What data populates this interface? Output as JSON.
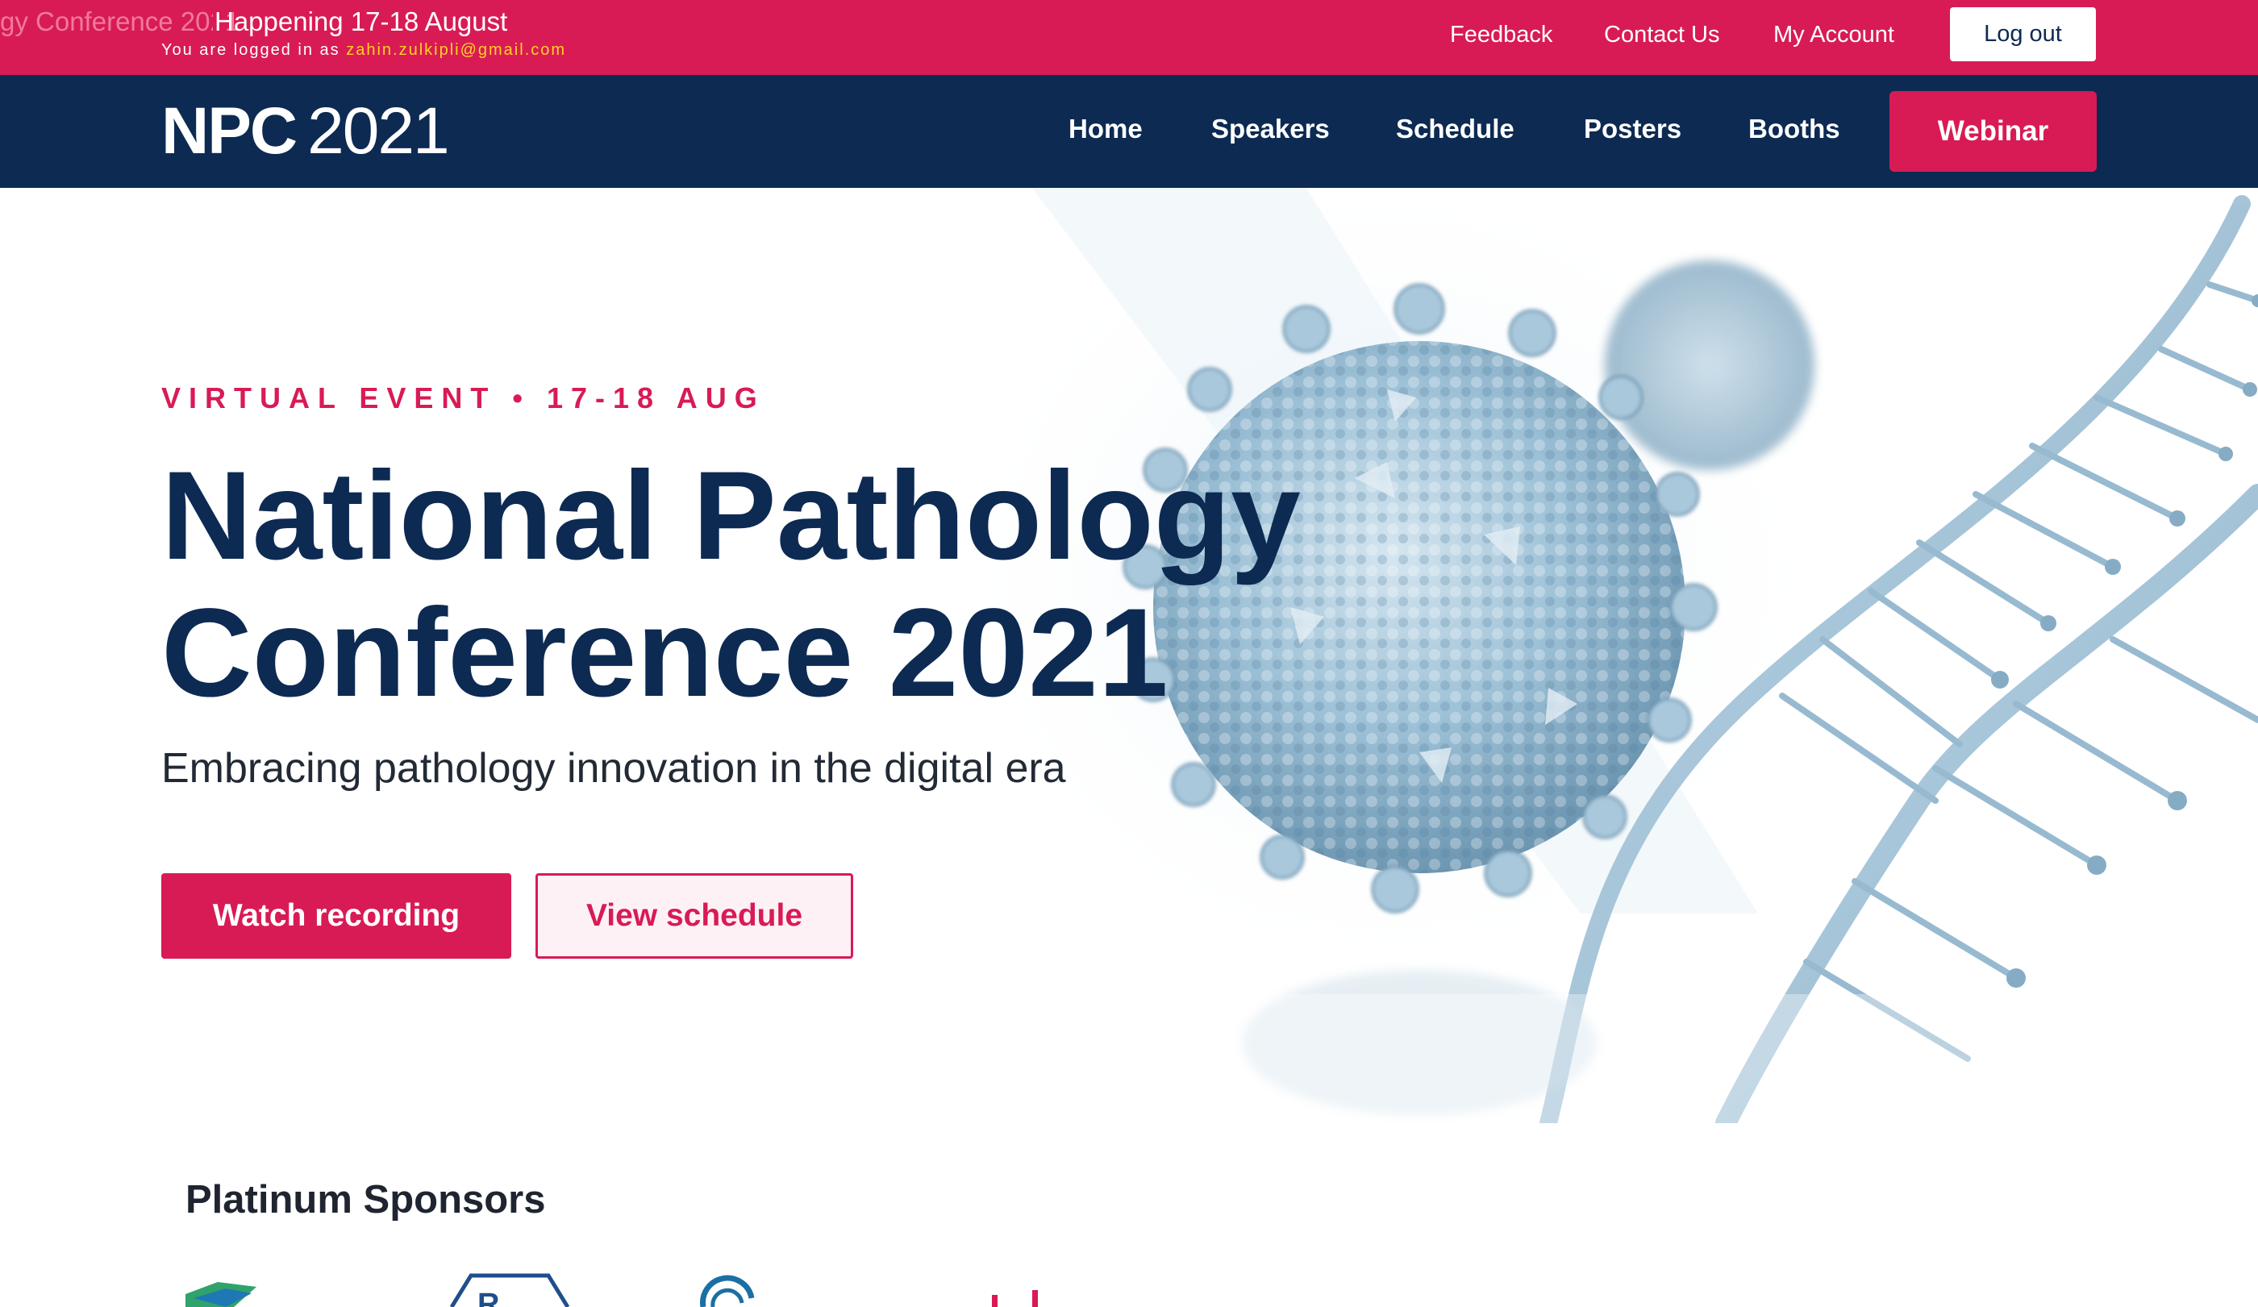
{
  "topbar": {
    "marquee_text": "gy Conference 2021",
    "happening": "Happening 17-18 August",
    "logged_prefix": "You are logged in as",
    "logged_email": "zahin.zulkipli@gmail.com",
    "links": [
      "Feedback",
      "Contact Us",
      "My Account"
    ],
    "logout_label": "Log out"
  },
  "nav": {
    "logo_text": "NPC",
    "logo_year": "2021",
    "items": [
      "Home",
      "Speakers",
      "Schedule",
      "Posters",
      "Booths"
    ],
    "webinar_label": "Webinar"
  },
  "hero": {
    "eyebrow": "VIRTUAL EVENT • 17-18 AUG",
    "title_line1": "National Pathology",
    "title_line2": "Conference 2021",
    "subtitle": "Embracing pathology innovation in the digital era",
    "watch_label": "Watch recording",
    "schedule_label": "View schedule"
  },
  "sponsors": {
    "title": "Platinum Sponsors"
  },
  "colors": {
    "brand_red": "#d81b55",
    "navy": "#0d2a52",
    "email_yellow": "#ffd21f",
    "art_blue": "#8fb6cf"
  }
}
